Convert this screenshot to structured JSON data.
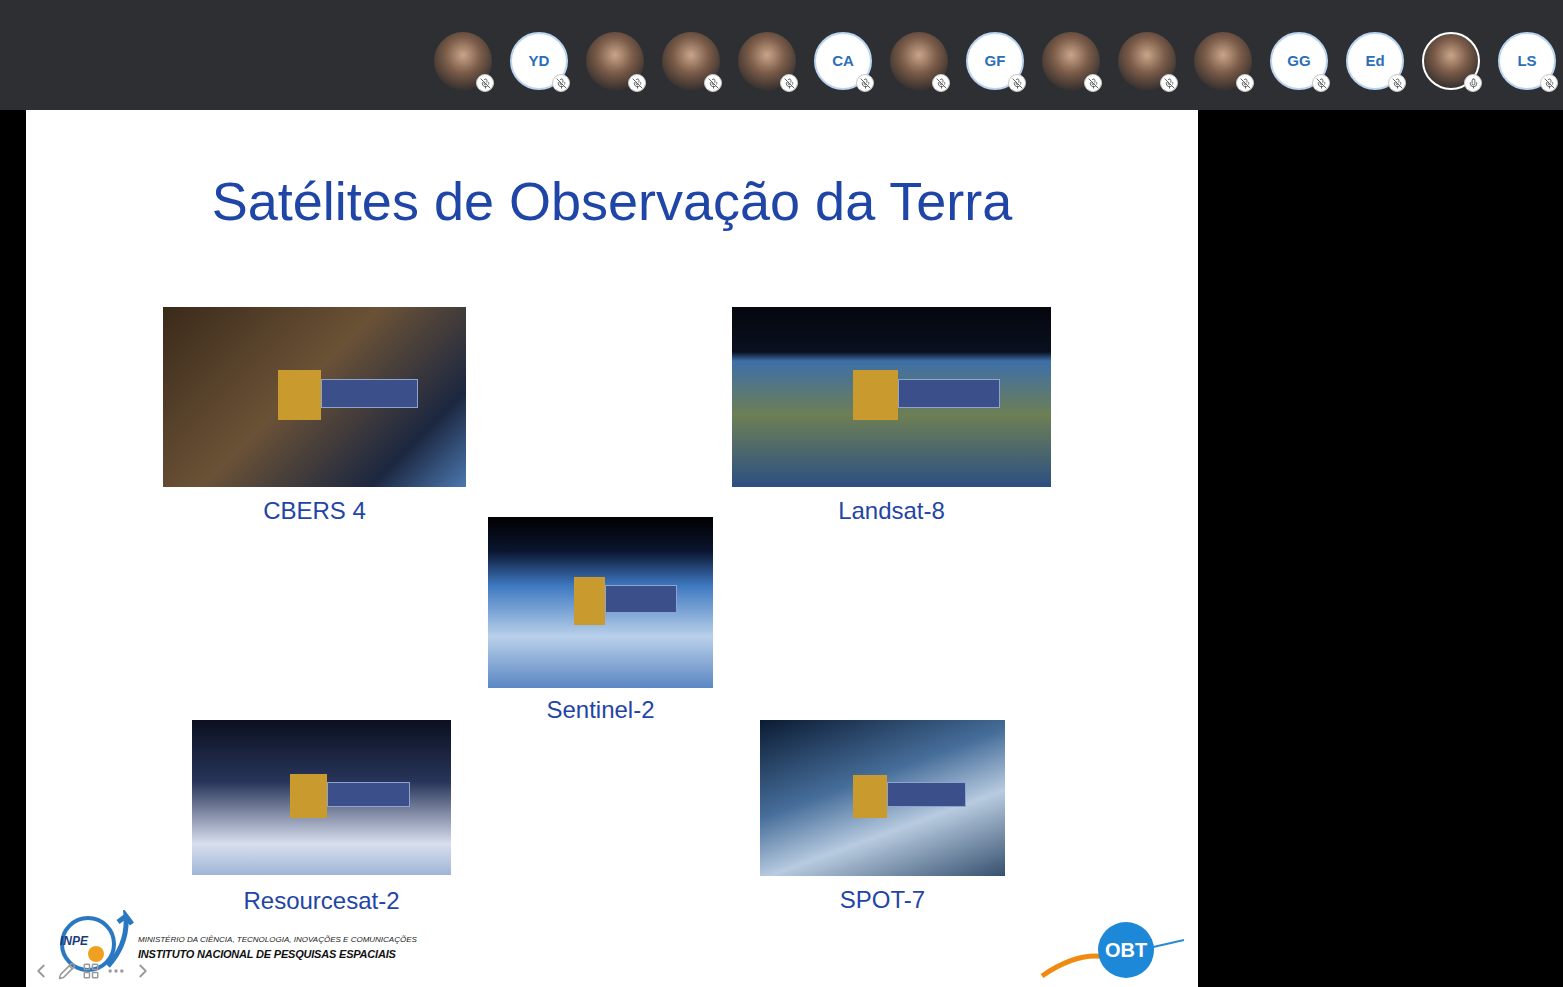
{
  "participants": [
    {
      "kind": "photo",
      "muted": true,
      "active": false
    },
    {
      "kind": "initials",
      "initials": "YD",
      "muted": true,
      "active": false
    },
    {
      "kind": "photo",
      "muted": true,
      "active": false
    },
    {
      "kind": "photo",
      "muted": true,
      "active": false
    },
    {
      "kind": "photo",
      "muted": true,
      "active": false
    },
    {
      "kind": "initials",
      "initials": "CA",
      "muted": true,
      "active": false
    },
    {
      "kind": "photo",
      "muted": true,
      "active": false
    },
    {
      "kind": "initials",
      "initials": "GF",
      "muted": true,
      "active": false
    },
    {
      "kind": "photo",
      "muted": true,
      "active": false
    },
    {
      "kind": "photo",
      "muted": true,
      "active": false
    },
    {
      "kind": "photo",
      "muted": true,
      "active": false
    },
    {
      "kind": "initials",
      "initials": "GG",
      "muted": true,
      "active": false
    },
    {
      "kind": "initials",
      "initials": "Ed",
      "muted": true,
      "active": false
    },
    {
      "kind": "photo",
      "muted": false,
      "active": true
    },
    {
      "kind": "initials",
      "initials": "LS",
      "muted": true,
      "active": false
    }
  ],
  "slide": {
    "title": "Satélites de Observação da Terra",
    "satellites": [
      {
        "name": "CBERS 4"
      },
      {
        "name": "Landsat-8"
      },
      {
        "name": "Sentinel-2"
      },
      {
        "name": "Resourcesat-2"
      },
      {
        "name": "SPOT-7"
      }
    ],
    "footer": {
      "logo": "INPE",
      "ministry": "MINISTÉRIO DA CIÊNCIA, TECNOLOGIA, INOVAÇÕES E COMUNICAÇÕES",
      "institute": "INSTITUTO NACIONAL DE PESQUISAS ESPACIAIS",
      "badge": "OBT"
    }
  }
}
